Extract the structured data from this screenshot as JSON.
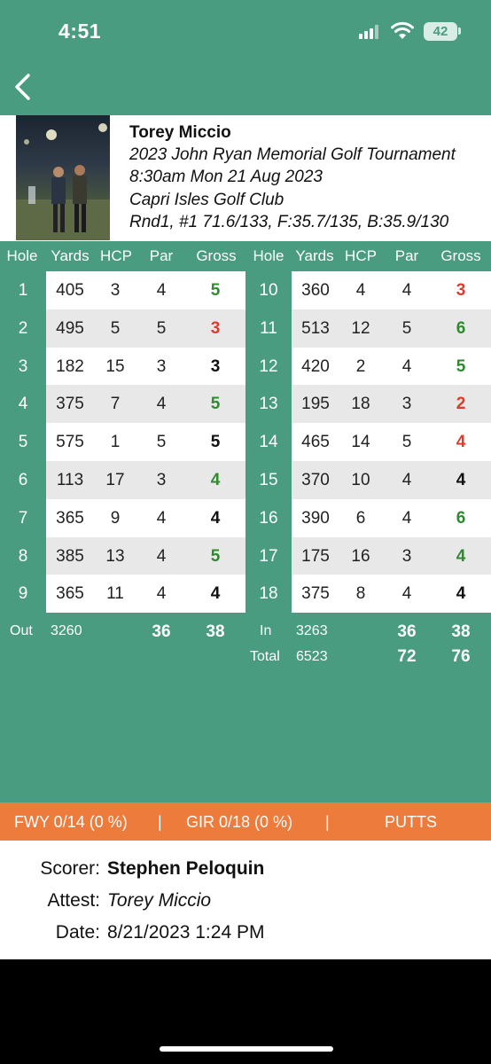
{
  "status": {
    "time": "4:51",
    "battery": "42"
  },
  "player": {
    "name": "Torey Miccio",
    "tournament": "2023 John Ryan Memorial Golf Tournament",
    "datetime": "8:30am Mon 21 Aug 2023",
    "club": "Capri Isles Golf Club",
    "round_info": "Rnd1, #1 71.6/133, F:35.7/135, B:35.9/130"
  },
  "columns": [
    "Hole",
    "Yards",
    "HCP",
    "Par",
    "Gross"
  ],
  "front_nine": [
    {
      "hole": "1",
      "yards": "405",
      "hcp": "3",
      "par": "4",
      "gross": "5"
    },
    {
      "hole": "2",
      "yards": "495",
      "hcp": "5",
      "par": "5",
      "gross": "3"
    },
    {
      "hole": "3",
      "yards": "182",
      "hcp": "15",
      "par": "3",
      "gross": "3"
    },
    {
      "hole": "4",
      "yards": "375",
      "hcp": "7",
      "par": "4",
      "gross": "5"
    },
    {
      "hole": "5",
      "yards": "575",
      "hcp": "1",
      "par": "5",
      "gross": "5"
    },
    {
      "hole": "6",
      "yards": "113",
      "hcp": "17",
      "par": "3",
      "gross": "4"
    },
    {
      "hole": "7",
      "yards": "365",
      "hcp": "9",
      "par": "4",
      "gross": "4"
    },
    {
      "hole": "8",
      "yards": "385",
      "hcp": "13",
      "par": "4",
      "gross": "5"
    },
    {
      "hole": "9",
      "yards": "365",
      "hcp": "11",
      "par": "4",
      "gross": "4"
    }
  ],
  "back_nine": [
    {
      "hole": "10",
      "yards": "360",
      "hcp": "4",
      "par": "4",
      "gross": "3"
    },
    {
      "hole": "11",
      "yards": "513",
      "hcp": "12",
      "par": "5",
      "gross": "6"
    },
    {
      "hole": "12",
      "yards": "420",
      "hcp": "2",
      "par": "4",
      "gross": "5"
    },
    {
      "hole": "13",
      "yards": "195",
      "hcp": "18",
      "par": "3",
      "gross": "2"
    },
    {
      "hole": "14",
      "yards": "465",
      "hcp": "14",
      "par": "5",
      "gross": "4"
    },
    {
      "hole": "15",
      "yards": "370",
      "hcp": "10",
      "par": "4",
      "gross": "4"
    },
    {
      "hole": "16",
      "yards": "390",
      "hcp": "6",
      "par": "4",
      "gross": "6"
    },
    {
      "hole": "17",
      "yards": "175",
      "hcp": "16",
      "par": "3",
      "gross": "4"
    },
    {
      "hole": "18",
      "yards": "375",
      "hcp": "8",
      "par": "4",
      "gross": "4"
    }
  ],
  "front_gross_colors": [
    "#2e8b2e",
    "#e03a2c",
    "#111111",
    "#2e8b2e",
    "#111111",
    "#2e8b2e",
    "#111111",
    "#2e8b2e",
    "#111111"
  ],
  "back_gross_colors": [
    "#e03a2c",
    "#2e8b2e",
    "#2e8b2e",
    "#e03a2c",
    "#e03a2c",
    "#111111",
    "#2e8b2e",
    "#2e8b2e",
    "#111111"
  ],
  "totals": {
    "out_label": "Out",
    "out_yards": "3260",
    "out_par": "36",
    "out_gross": "38",
    "in_label": "In",
    "in_yards": "3263",
    "in_par": "36",
    "in_gross": "38",
    "total_label": "Total",
    "total_yards": "6523",
    "total_par": "72",
    "total_gross": "76"
  },
  "stats": {
    "fwy": "FWY 0/14 (0 %)",
    "sep1": "|",
    "gir": "GIR 0/18 (0 %)",
    "sep2": "|",
    "putts": "PUTTS"
  },
  "signature": {
    "scorer_label": "Scorer:",
    "scorer": "Stephen Peloquin",
    "attest_label": "Attest:",
    "attest": "Torey Miccio",
    "date_label": "Date:",
    "date": "8/21/2023 1:24 PM"
  },
  "colors": {
    "green": "#4a9c80",
    "orange": "#ed7b3c",
    "under_par": "#e03a2c",
    "over_par": "#2e8b2e"
  }
}
